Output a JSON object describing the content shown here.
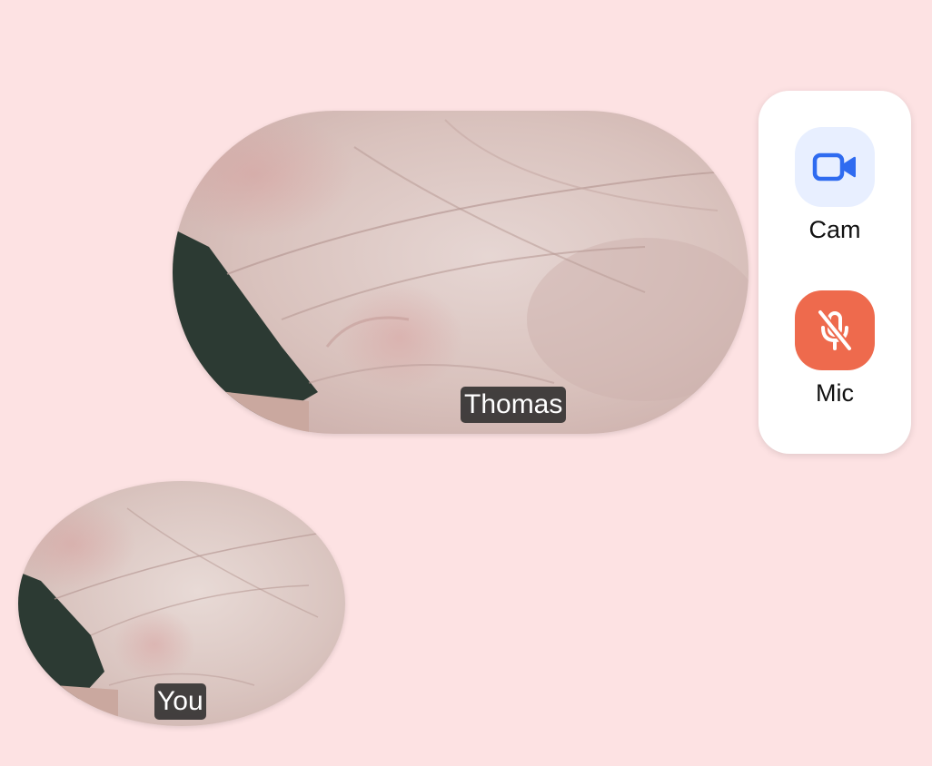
{
  "remote_participant": {
    "name": "Thomas"
  },
  "local_participant": {
    "name": "You"
  },
  "controls": {
    "camera": {
      "label": "Cam",
      "icon": "video-camera-icon",
      "state": "on",
      "color": "#2f6bf0",
      "bg": "#e8efff"
    },
    "microphone": {
      "label": "Mic",
      "icon": "microphone-off-icon",
      "state": "muted",
      "color": "#ffffff",
      "bg": "#ee6a4d"
    }
  },
  "colors": {
    "background": "#fde2e3",
    "panel": "#ffffff",
    "name_tag": "#2e2e2e"
  }
}
